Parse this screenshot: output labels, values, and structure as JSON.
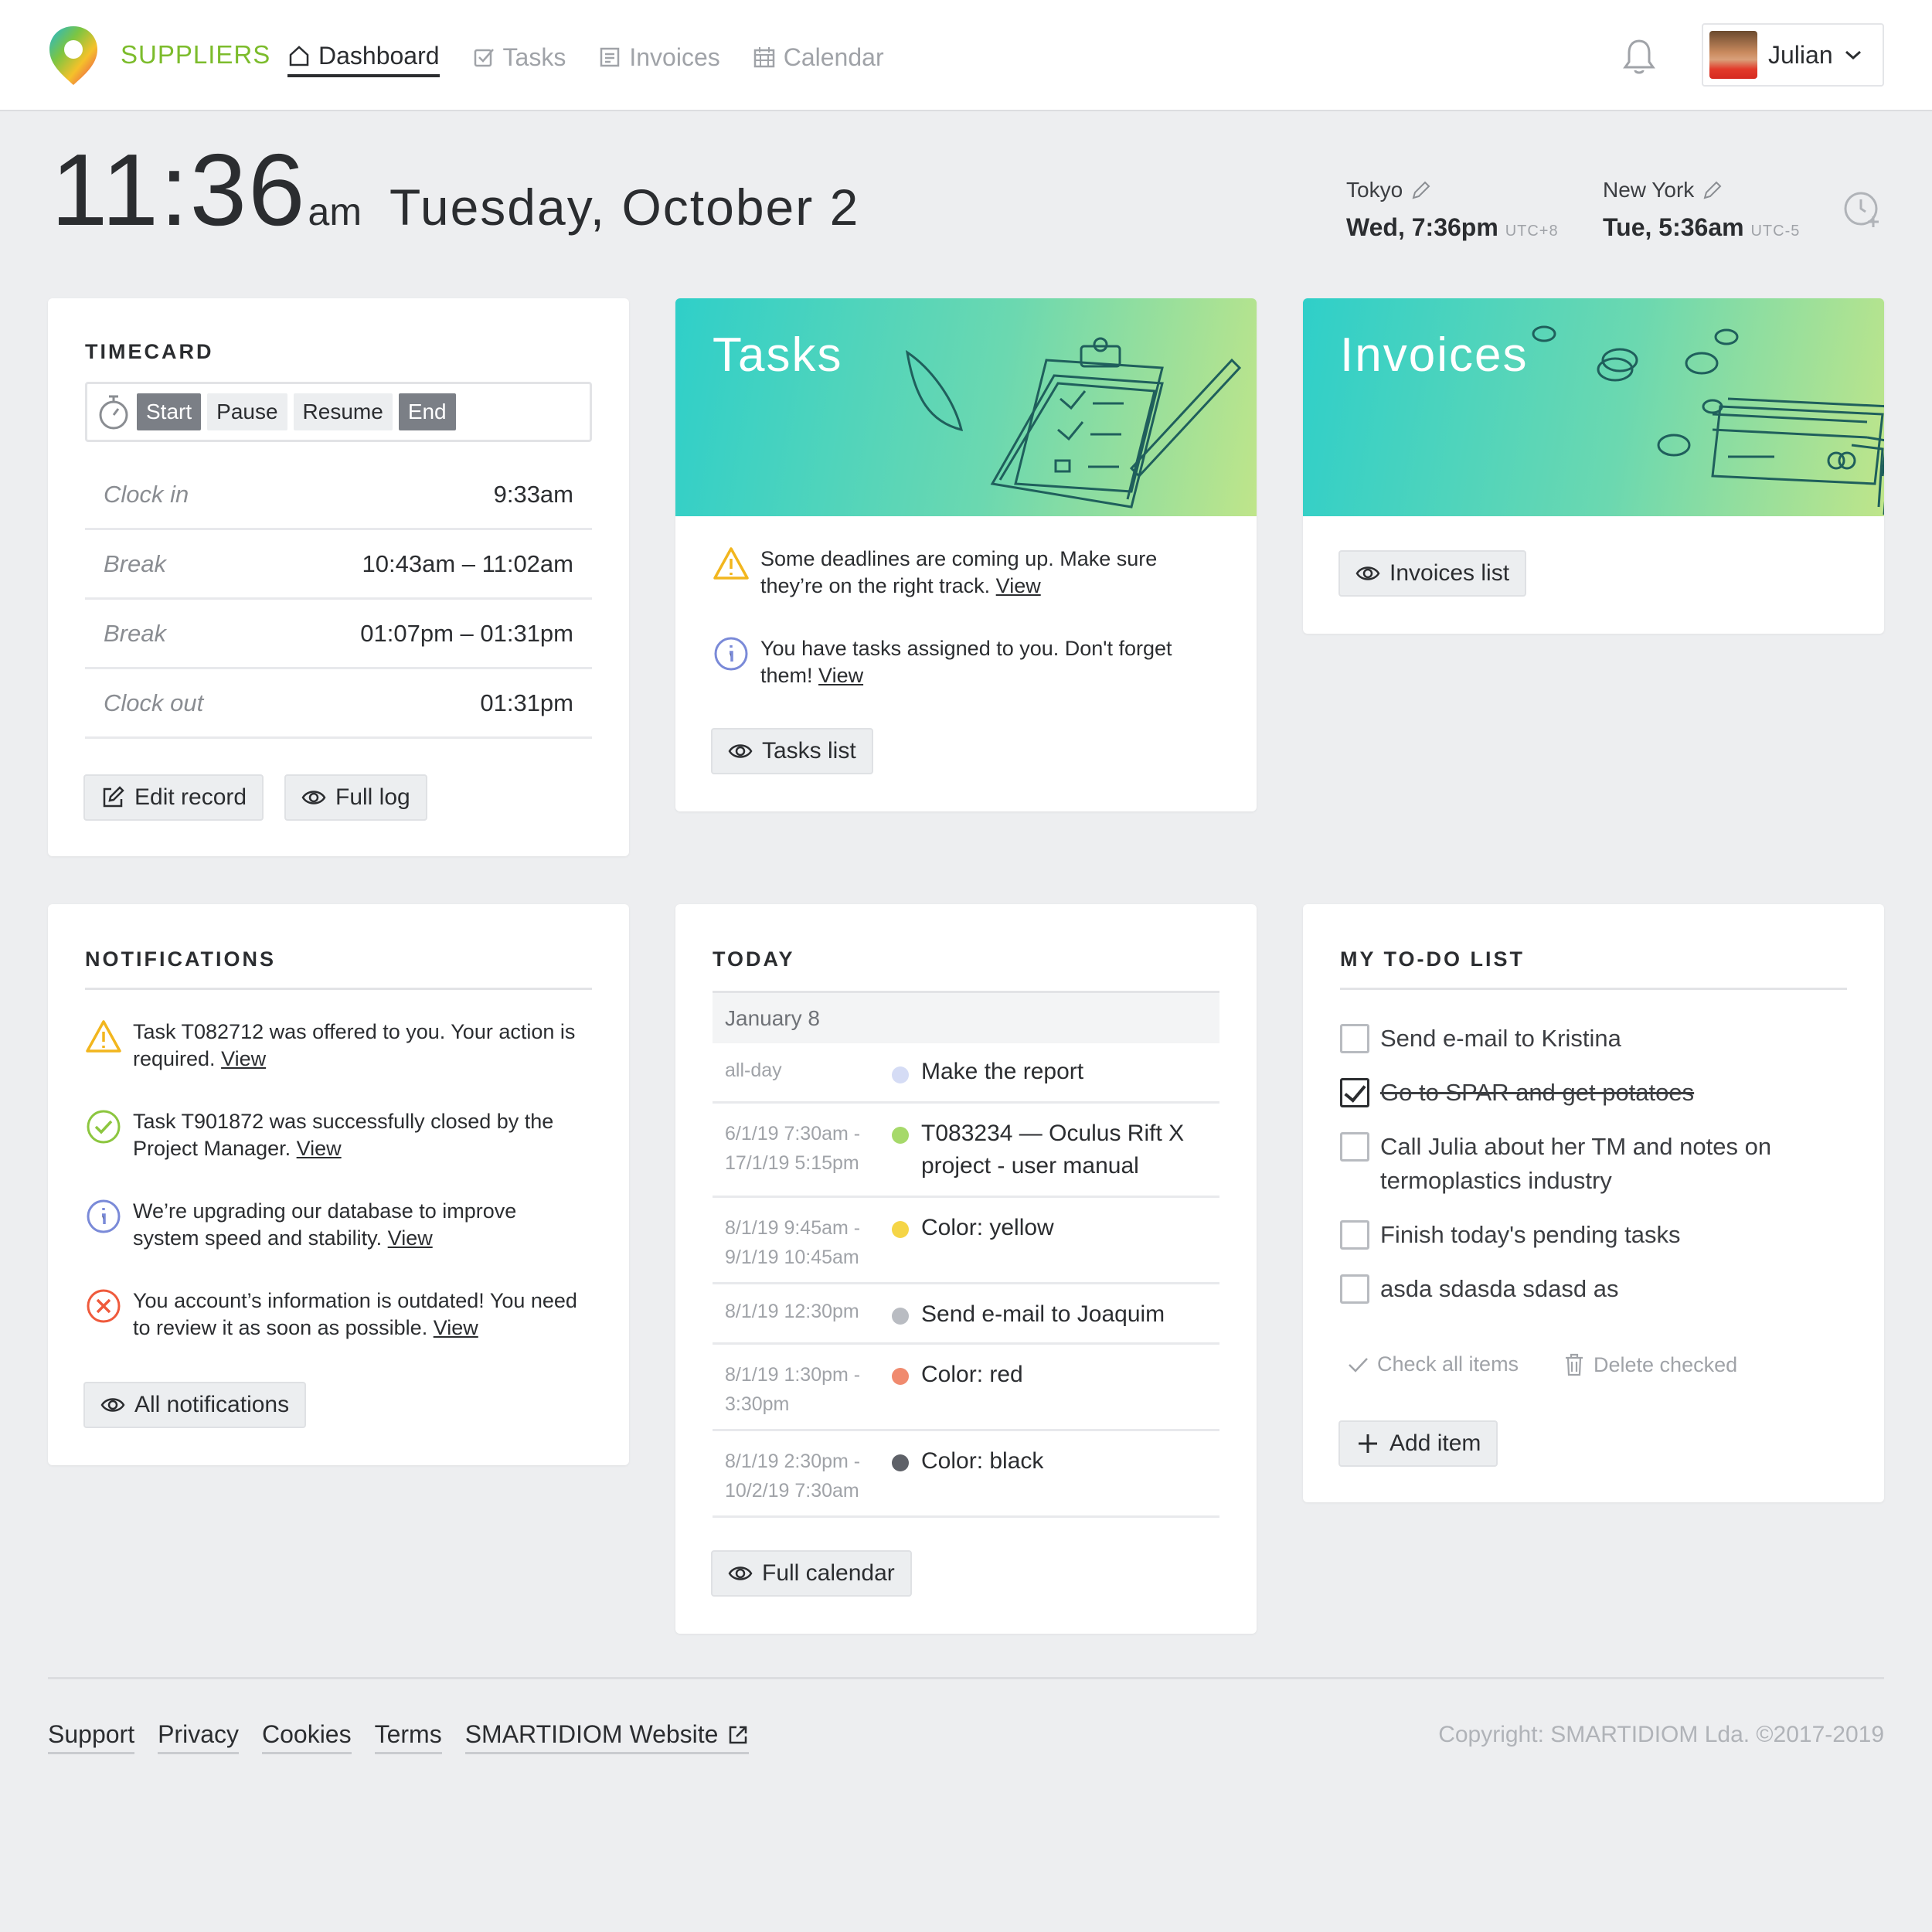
{
  "app": {
    "brand": "SUPPLIERS"
  },
  "nav": [
    {
      "label": "Dashboard",
      "active": true,
      "icon": "home-icon"
    },
    {
      "label": "Tasks",
      "active": false,
      "icon": "checkbox-icon"
    },
    {
      "label": "Invoices",
      "active": false,
      "icon": "receipt-icon"
    },
    {
      "label": "Calendar",
      "active": false,
      "icon": "calendar-icon"
    }
  ],
  "user": {
    "name": "Julian"
  },
  "clock": {
    "time": "11:36",
    "ampm": "am",
    "date": "Tuesday,  October 2"
  },
  "timezones": [
    {
      "city": "Tokyo",
      "time": "Wed, 7:36pm",
      "utc": "UTC+8"
    },
    {
      "city": "New York",
      "time": "Tue, 5:36am",
      "utc": "UTC-5"
    }
  ],
  "timecard": {
    "title": "TIMECARD",
    "controls": [
      "Start",
      "Pause",
      "Resume",
      "End"
    ],
    "rows": [
      {
        "label": "Clock in",
        "value": "9:33am"
      },
      {
        "label": "Break",
        "value": "10:43am – 11:02am"
      },
      {
        "label": "Break",
        "value": "01:07pm – 01:31pm"
      },
      {
        "label": "Clock out",
        "value": "01:31pm"
      }
    ],
    "edit_label": "Edit record",
    "log_label": "Full log"
  },
  "tasks": {
    "title": "Tasks",
    "msg1": "Some deadlines are coming up. Make sure they’re on the right track.",
    "msg2": "You have tasks assigned to you. Don't forget them!",
    "view": "View",
    "button": "Tasks list"
  },
  "invoices": {
    "title": "Invoices",
    "button": "Invoices list"
  },
  "notifications": {
    "title": "NOTIFICATIONS",
    "items": [
      {
        "type": "warning",
        "text": "Task T082712 was offered to you. Your action is required."
      },
      {
        "type": "success",
        "text": "Task T901872 was successfully closed by the Project Manager."
      },
      {
        "type": "info",
        "text": "We’re upgrading our database to improve system speed and stability."
      },
      {
        "type": "error",
        "text": "You account’s information is outdated! You need to review it as soon as possible."
      }
    ],
    "view": "View",
    "button": "All notifications"
  },
  "today": {
    "title": "TODAY",
    "date": "January 8",
    "events": [
      {
        "when": "all-day",
        "what": "Make the report",
        "color": "#d5dcf5"
      },
      {
        "when": "6/1/19 7:30am - 17/1/19 5:15pm",
        "what": "T083234 — Oculus Rift X project - user manual",
        "color": "#a6d96a"
      },
      {
        "when": "8/1/19 9:45am - 9/1/19 10:45am",
        "what": "Color: yellow",
        "color": "#f5d547"
      },
      {
        "when": "8/1/19 12:30pm",
        "what": "Send e-mail to Joaquim",
        "color": "#b9bcc2"
      },
      {
        "when": "8/1/19 1:30pm - 3:30pm",
        "what": "Color: red",
        "color": "#f08a6e"
      },
      {
        "when": "8/1/19 2:30pm - 10/2/19 7:30am",
        "what": "Color: black",
        "color": "#5e6168"
      }
    ],
    "button": "Full calendar"
  },
  "todo": {
    "title": "MY TO-DO LIST",
    "items": [
      {
        "text": "Send e-mail to Kristina",
        "done": false
      },
      {
        "text": "Go to SPAR and get potatoes",
        "done": true
      },
      {
        "text": "Call Julia about her TM and notes on termoplastics industry",
        "done": false
      },
      {
        "text": "Finish today's pending tasks",
        "done": false
      },
      {
        "text": "asda sdasda sdasd as",
        "done": false
      }
    ],
    "check_all": "Check all items",
    "delete_checked": "Delete checked",
    "add": "Add item"
  },
  "footer": {
    "links": [
      "Support",
      "Privacy",
      "Cookies",
      "Terms",
      "SMARTIDIOM Website"
    ],
    "copyright": "Copyright: SMARTIDIOM Lda. ©2017-2019"
  }
}
